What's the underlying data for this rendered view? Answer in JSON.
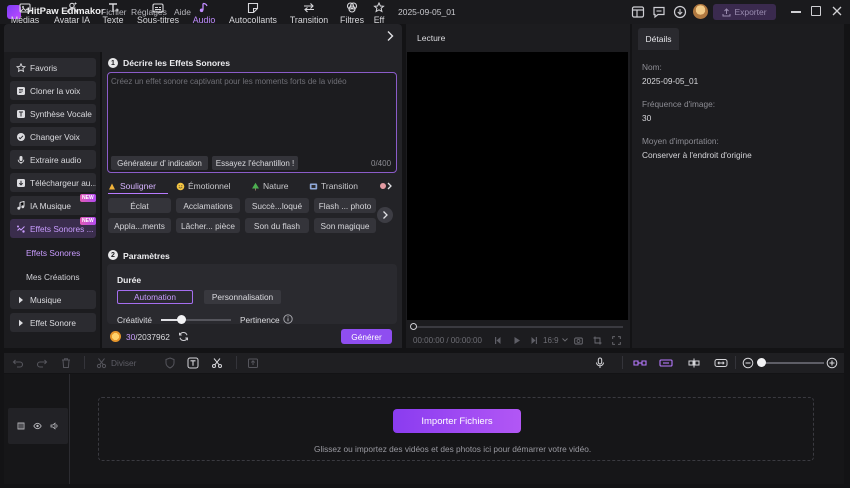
{
  "app": {
    "name": "HitPaw Edimakor",
    "menu": [
      "Fichier",
      "Réglages",
      "Aide"
    ],
    "document_title": "2025-09-05_01",
    "export_label": "Exporter"
  },
  "toolbar": {
    "tools": [
      {
        "label": "Médias",
        "icon": "media-icon"
      },
      {
        "label": "Avatar IA",
        "icon": "avatar-ai-icon"
      },
      {
        "label": "Texte",
        "icon": "text-icon"
      },
      {
        "label": "Sous-titres",
        "icon": "subtitles-icon"
      },
      {
        "label": "Audio",
        "icon": "audio-icon",
        "active": true
      },
      {
        "label": "Autocollants",
        "icon": "sticker-icon"
      },
      {
        "label": "Transition",
        "icon": "transition-icon"
      },
      {
        "label": "Filtres",
        "icon": "filter-icon"
      },
      {
        "label": "Eff",
        "icon": "effects-icon"
      }
    ]
  },
  "sidebar": {
    "items": [
      {
        "label": "Favoris",
        "icon": "star-icon"
      },
      {
        "label": "Cloner la voix",
        "icon": "voice-clone-icon"
      },
      {
        "label": "Synthèse Vocale",
        "icon": "tts-icon"
      },
      {
        "label": "Changer Voix",
        "icon": "voice-change-icon"
      },
      {
        "label": "Extraire audio",
        "icon": "mic-icon"
      },
      {
        "label": "Téléchargeur au...",
        "icon": "download-icon"
      },
      {
        "label": "IA Musique",
        "icon": "music-ai-icon",
        "badge": "NEW"
      },
      {
        "label": "Effets Sonores ...",
        "icon": "sfx-icon",
        "badge": "NEW",
        "active": true
      }
    ],
    "sub_items": [
      {
        "label": "Effets Sonores",
        "active": true
      },
      {
        "label": "Mes Créations"
      }
    ],
    "folders": [
      {
        "label": "Musique"
      },
      {
        "label": "Effet Sonore"
      }
    ]
  },
  "generator": {
    "section1_num": "1",
    "section1_title": "Décrire les Effets Sonores",
    "placeholder": "Créez un effet sonore captivant pour les moments forts de la vidéo",
    "chip_prompt": "Générateur d'   indication",
    "chip_sample": "Essayez l'échantillon !",
    "char_count": "0/400",
    "categories": [
      {
        "label": "Souligner",
        "active": true
      },
      {
        "label": "Émotionnel"
      },
      {
        "label": "Nature"
      },
      {
        "label": "Transition"
      }
    ],
    "sfx_row1": [
      "Éclat",
      "Acclamations",
      "Succè...loqué",
      "Flash ... photo"
    ],
    "sfx_row2": [
      "Appla...ments",
      "Lâcher... pièce",
      "Son du flash",
      "Son magique"
    ],
    "section2_num": "2",
    "section2_title": "Paramètres",
    "duree_label": "Durée",
    "automation_label": "Automation",
    "personnalisation_label": "Personnalisation",
    "creativite_label": "Créativité",
    "creativity_level": 0.28,
    "pertinence_label": "Pertinence",
    "credits_used": "30",
    "credits_total": "/2037962",
    "generate_label": "Générer"
  },
  "preview": {
    "title": "Lecture",
    "timecode": "00:00:00 / 00:00:00",
    "aspect": "16:9"
  },
  "details": {
    "tab": "Détails",
    "name_label": "Nom:",
    "name_value": "2025-09-05_01",
    "fps_label": "Fréquence d'image:",
    "fps_value": "30",
    "import_label": "Moyen d'importation:",
    "import_value": "Conserver à l'endroit d'origine"
  },
  "timeline": {
    "split_label": "Diviser",
    "import_button": "Importer Fichiers",
    "drop_hint": "Glissez ou importez des vidéos et des photos ici pour démarrer votre vidéo."
  }
}
